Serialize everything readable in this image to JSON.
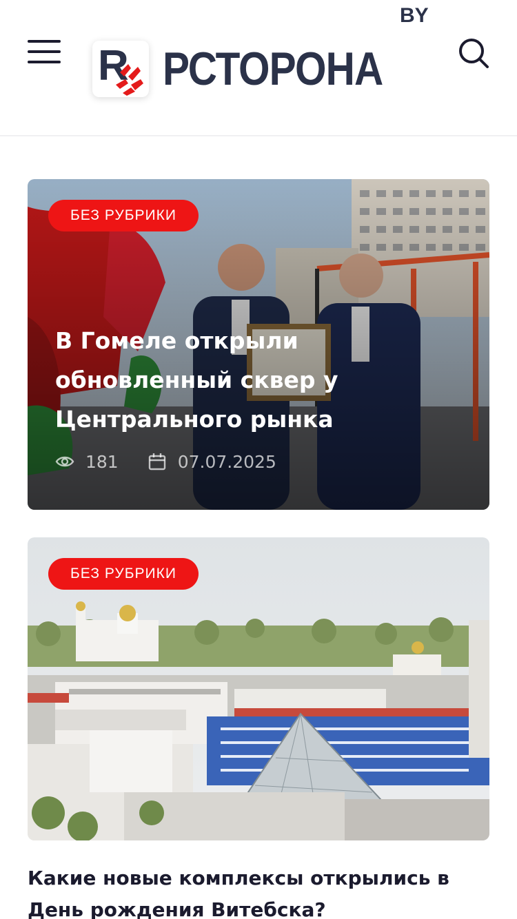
{
  "header": {
    "logo_letter": "R",
    "logo_text": "РСТОРОНА",
    "logo_suffix": "BY"
  },
  "colors": {
    "accent": "#ee1515",
    "brand": "#2b3249",
    "text": "#1b1b2e"
  },
  "icons": {
    "menu": "hamburger-icon",
    "search": "search-icon",
    "views": "eye-icon",
    "date": "calendar-icon"
  },
  "articles": [
    {
      "category": "БЕЗ РУБРИКИ",
      "title": "В Гомеле открыли обновленный сквер у Центрального рынка",
      "views": "181",
      "date": "07.07.2025"
    },
    {
      "category": "БЕЗ РУБРИКИ",
      "title": "Какие новые комплексы открылись в День рождения Витебска?"
    }
  ]
}
